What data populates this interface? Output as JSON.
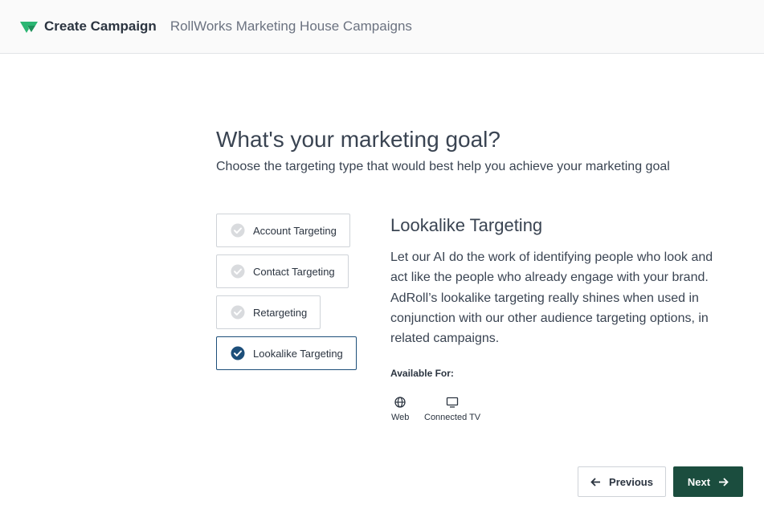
{
  "header": {
    "title": "Create Campaign",
    "subtitle": "RollWorks Marketing House Campaigns",
    "logo_icon": "rollworks-logo-icon",
    "brand_color": "#2bb673"
  },
  "goal": {
    "title": "What's your marketing goal?",
    "subtitle": "Choose the targeting type that would best help you achieve your marketing goal"
  },
  "options": [
    {
      "label": "Account Targeting",
      "selected": false
    },
    {
      "label": "Contact Targeting",
      "selected": false
    },
    {
      "label": "Retargeting",
      "selected": false
    },
    {
      "label": "Lookalike Targeting",
      "selected": true
    }
  ],
  "detail": {
    "title": "Lookalike Targeting",
    "description": "Let our AI do the work of identifying people who look and act like the people who already engage with your brand. AdRoll’s lookalike targeting really shines when used in conjunction with our other audience targeting options, in related campaigns.",
    "available_label": "Available For:",
    "channels": [
      {
        "label": "Web",
        "icon": "globe-icon"
      },
      {
        "label": "Connected TV",
        "icon": "tv-icon"
      }
    ]
  },
  "footer": {
    "previous_label": "Previous",
    "next_label": "Next",
    "next_color": "#1b4d3e",
    "selected_color": "#1d4f7a"
  }
}
